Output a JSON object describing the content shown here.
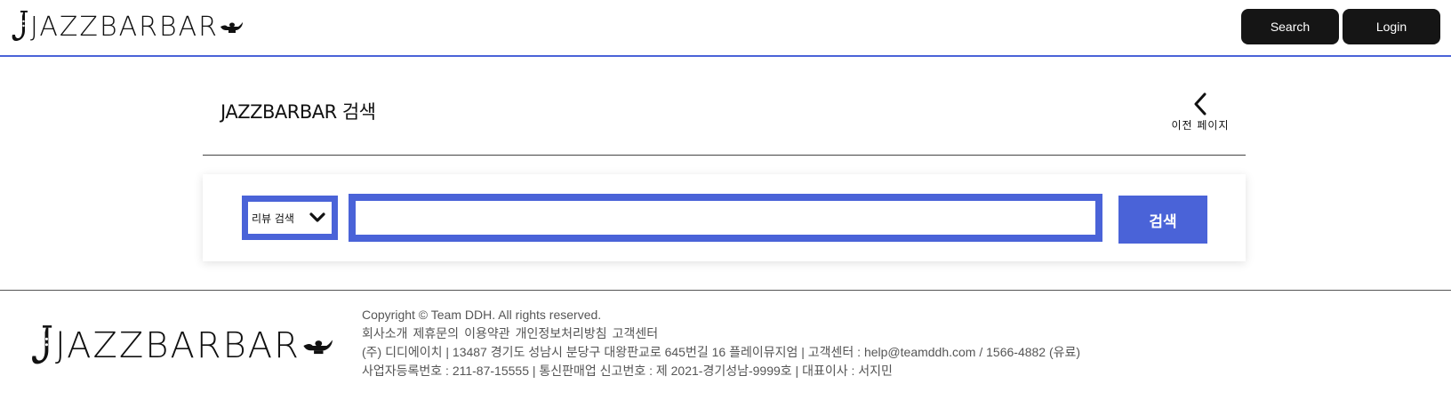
{
  "header": {
    "logo_text": "JAZZBARBAR",
    "search_label": "Search",
    "login_label": "Login"
  },
  "page": {
    "title": "JAZZBARBAR 검색",
    "back_label": "이전 페이지"
  },
  "search": {
    "select_value": "리뷰 검색",
    "input_value": "",
    "button_label": "검색"
  },
  "footer": {
    "logo_text": "JAZZBARBAR",
    "copyright": "Copyright © Team DDH. All rights reserved.",
    "links": [
      "회사소개",
      "제휴문의",
      "이용약관",
      "개인정보처리방침",
      "고객센터"
    ],
    "company_line": "(주) 디디에이치 | 13487 경기도 성남시 분당구 대왕판교로 645번길 16 플레이뮤지엄 | 고객센터 : help@teamddh.com / 1566-4882 (유료)",
    "registration_line": "사업자등록번호 : 211-87-15555 | 통신판매업 신고번호 : 제 2021-경기성남-9999호 | 대표이사 : 서지민"
  },
  "colors": {
    "accent": "#4a63d8",
    "header_button": "#151515"
  },
  "icons": {
    "logo_left": "saxophone-icon",
    "logo_right": "genie-lamp-icon",
    "select_arrow": "chevron-down-icon",
    "back": "chevron-left-icon"
  }
}
